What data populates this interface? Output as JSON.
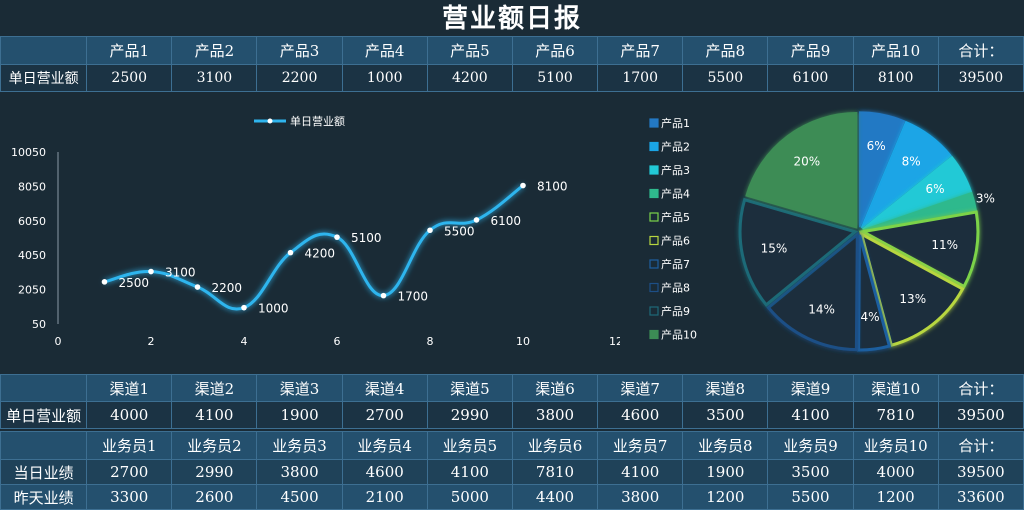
{
  "title": "营业额日报",
  "table_products": {
    "headers": [
      "",
      "产品1",
      "产品2",
      "产品3",
      "产品4",
      "产品5",
      "产品6",
      "产品7",
      "产品8",
      "产品9",
      "产品10",
      "合计："
    ],
    "row": [
      "单日营业额",
      "2500",
      "3100",
      "2200",
      "1000",
      "4200",
      "5100",
      "1700",
      "5500",
      "6100",
      "8100",
      "39500"
    ]
  },
  "table_channels": {
    "headers": [
      "",
      "渠道1",
      "渠道2",
      "渠道3",
      "渠道4",
      "渠道5",
      "渠道6",
      "渠道7",
      "渠道8",
      "渠道9",
      "渠道10",
      "合计："
    ],
    "row": [
      "单日营业额",
      "4000",
      "4100",
      "1900",
      "2700",
      "2990",
      "3800",
      "4600",
      "3500",
      "4100",
      "7810",
      "39500"
    ]
  },
  "table_staff": {
    "headers": [
      "",
      "业务员1",
      "业务员2",
      "业务员3",
      "业务员4",
      "业务员5",
      "业务员6",
      "业务员7",
      "业务员8",
      "业务员9",
      "业务员10",
      "合计："
    ],
    "rows": [
      [
        "当日业绩",
        "2700",
        "2990",
        "3800",
        "4600",
        "4100",
        "7810",
        "4100",
        "1900",
        "3500",
        "4000",
        "39500"
      ],
      [
        "昨天业绩",
        "3300",
        "2600",
        "4500",
        "2100",
        "5000",
        "4400",
        "3800",
        "1200",
        "5500",
        "1200",
        "33600"
      ]
    ]
  },
  "chart_data": [
    {
      "type": "line",
      "legend": "单日营业额",
      "legend_position": "top",
      "x": [
        1,
        2,
        3,
        4,
        5,
        6,
        7,
        8,
        9,
        10
      ],
      "values": [
        2500,
        3100,
        2200,
        1000,
        4200,
        5100,
        1700,
        5500,
        6100,
        8100
      ],
      "data_labels": [
        "2500",
        "3100",
        "2200",
        "1000",
        "4200",
        "5100",
        "1700",
        "5500",
        "6100",
        "8100"
      ],
      "x_ticks": [
        "0",
        "2",
        "4",
        "6",
        "8",
        "10",
        "12"
      ],
      "x_tick_values": [
        0,
        2,
        4,
        6,
        8,
        10,
        12
      ],
      "y_ticks": [
        "50",
        "2050",
        "4050",
        "6050",
        "8050",
        "10050"
      ],
      "y_tick_values": [
        50,
        2050,
        4050,
        6050,
        8050,
        10050
      ],
      "xlim": [
        0,
        12
      ],
      "ylim": [
        50,
        10050
      ],
      "grid": false,
      "color": "#2fb5ee"
    },
    {
      "type": "pie",
      "legend_position": "left",
      "categories": [
        "产品1",
        "产品2",
        "产品3",
        "产品4",
        "产品5",
        "产品6",
        "产品7",
        "产品8",
        "产品9",
        "产品10"
      ],
      "values": [
        2500,
        3100,
        2200,
        1000,
        4200,
        5100,
        1700,
        5500,
        6100,
        8100
      ],
      "labels": [
        "6%",
        "8%",
        "6%",
        "3%",
        "11%",
        "13%",
        "4%",
        "14%",
        "15%",
        "20%"
      ],
      "colors": [
        "#2379c4",
        "#1aa5e6",
        "#22c9d6",
        "#2fb98d",
        "#1d3140",
        "#1d3140",
        "#1a2b36",
        "#1a2b36",
        "#1a2b36",
        "#3c8c55"
      ],
      "strokes": [
        "#2379c4",
        "#1aa5e6",
        "#22c9d6",
        "#2fb98d",
        "#7bd34a",
        "#b8d640",
        "#1f5fa0",
        "#1d4f86",
        "#1e6a78",
        "#3c8c55"
      ],
      "filled": [
        true,
        true,
        true,
        true,
        false,
        false,
        false,
        false,
        false,
        true
      ]
    }
  ]
}
